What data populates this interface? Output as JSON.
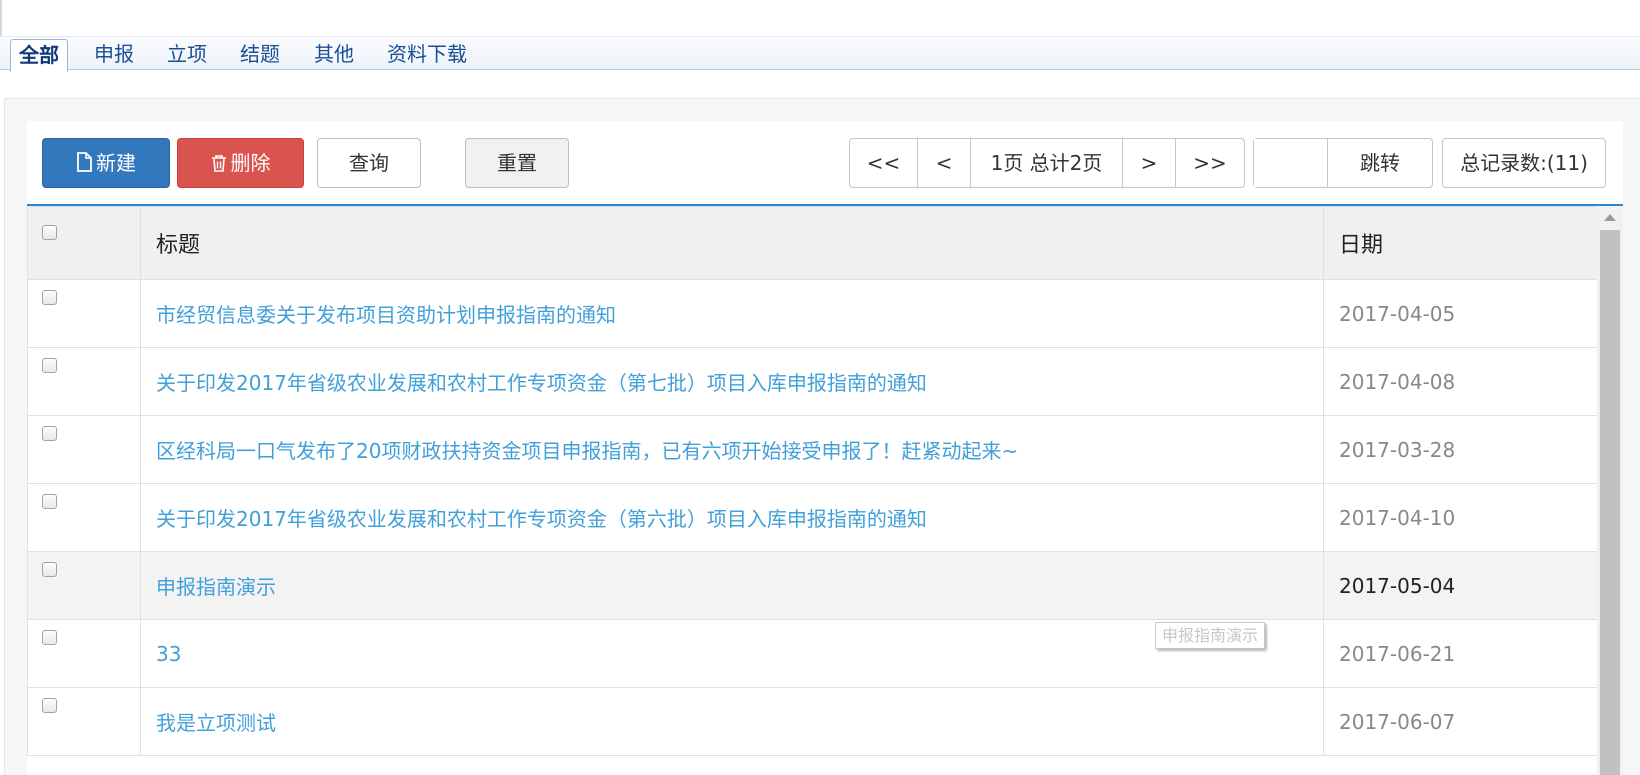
{
  "tabs": [
    {
      "label": "全部",
      "active": true
    },
    {
      "label": "申报",
      "active": false
    },
    {
      "label": "立项",
      "active": false
    },
    {
      "label": "结题",
      "active": false
    },
    {
      "label": "其他",
      "active": false
    },
    {
      "label": "资料下载",
      "active": false
    }
  ],
  "toolbar": {
    "new_label": "新建",
    "delete_label": "删除",
    "query_label": "查询",
    "reset_label": "重置"
  },
  "pager": {
    "first": "<<",
    "prev": "<",
    "page_info": "1页 总计2页",
    "next": ">",
    "last": ">>",
    "jump_value": "",
    "jump_label": "跳转",
    "total": "总记录数:(11)"
  },
  "table": {
    "headers": {
      "title": "标题",
      "date": "日期"
    },
    "rows": [
      {
        "title": "市经贸信息委关于发布项目资助计划申报指南的通知",
        "date": "2017-04-05"
      },
      {
        "title": "关于印发2017年省级农业发展和农村工作专项资金（第七批）项目入库申报指南的通知",
        "date": "2017-04-08"
      },
      {
        "title": "区经科局一口气发布了20项财政扶持资金项目申报指南，已有六项开始接受申报了！赶紧动起来~",
        "date": "2017-03-28"
      },
      {
        "title": "关于印发2017年省级农业发展和农村工作专项资金（第六批）项目入库申报指南的通知",
        "date": "2017-04-10"
      },
      {
        "title": "申报指南演示",
        "date": "2017-05-04"
      },
      {
        "title": "33",
        "date": "2017-06-21"
      },
      {
        "title": "我是立项测试",
        "date": "2017-06-07"
      }
    ]
  },
  "tooltip": "申报指南演示",
  "colors": {
    "primary": "#3378bd",
    "danger": "#d9534f",
    "link": "#42a0d9",
    "accent_line": "#2e86cf"
  }
}
